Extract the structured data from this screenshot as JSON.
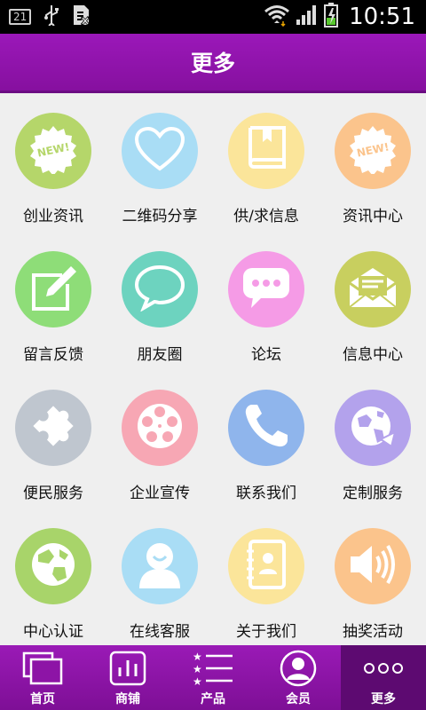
{
  "status_bar": {
    "notification_badge": "21",
    "time": "10:51"
  },
  "header": {
    "title": "更多"
  },
  "grid": {
    "items": [
      {
        "label": "创业资讯",
        "icon": "new-badge-icon",
        "color": "#b5d66a"
      },
      {
        "label": "二维码分享",
        "icon": "heart-icon",
        "color": "#a9ddf5"
      },
      {
        "label": "供/求信息",
        "icon": "book-icon",
        "color": "#fbe59a"
      },
      {
        "label": "资讯中心",
        "icon": "new-badge-icon",
        "color": "#fbc48c"
      },
      {
        "label": "留言反馈",
        "icon": "edit-icon",
        "color": "#8edd78"
      },
      {
        "label": "朋友圈",
        "icon": "chat-bubble-icon",
        "color": "#6dd3bf"
      },
      {
        "label": "论坛",
        "icon": "speech-dots-icon",
        "color": "#f59be6"
      },
      {
        "label": "信息中心",
        "icon": "envelope-icon",
        "color": "#c8cf5f"
      },
      {
        "label": "便民服务",
        "icon": "puzzle-icon",
        "color": "#bfc6cf"
      },
      {
        "label": "企业宣传",
        "icon": "film-reel-icon",
        "color": "#f7a7b4"
      },
      {
        "label": "联系我们",
        "icon": "phone-icon",
        "color": "#8fb5ec"
      },
      {
        "label": "定制服务",
        "icon": "globe-arrow-icon",
        "color": "#b3a2ec"
      },
      {
        "label": "中心认证",
        "icon": "globe-icon",
        "color": "#a8d46a"
      },
      {
        "label": "在线客服",
        "icon": "user-icon",
        "color": "#a9ddf5"
      },
      {
        "label": "关于我们",
        "icon": "contacts-book-icon",
        "color": "#fbe59a"
      },
      {
        "label": "抽奖活动",
        "icon": "speaker-icon",
        "color": "#fbc48c"
      }
    ]
  },
  "bottom_nav": {
    "items": [
      {
        "label": "首页",
        "icon": "home-windows-icon"
      },
      {
        "label": "商铺",
        "icon": "store-bars-icon"
      },
      {
        "label": "产品",
        "icon": "star-list-icon"
      },
      {
        "label": "会员",
        "icon": "member-avatar-icon"
      },
      {
        "label": "更多",
        "icon": "more-dots-icon",
        "active": true
      }
    ]
  }
}
